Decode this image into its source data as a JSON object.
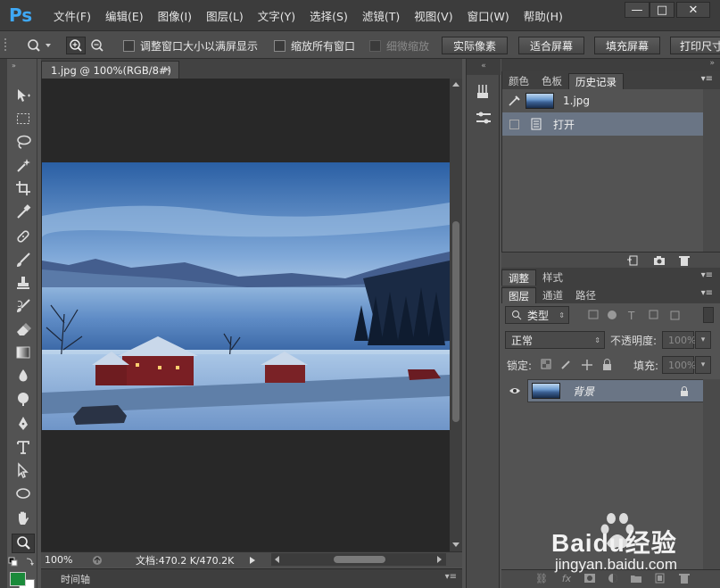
{
  "app": {
    "logo": "Ps",
    "accent": "#3fa8f5"
  },
  "menu": [
    "文件(F)",
    "编辑(E)",
    "图像(I)",
    "图层(L)",
    "文字(Y)",
    "选择(S)",
    "滤镜(T)",
    "视图(V)",
    "窗口(W)",
    "帮助(H)"
  ],
  "window_controls": {
    "minimize": "—",
    "restore": "□",
    "close": "✕"
  },
  "options": {
    "resize_windows": "调整窗口大小以满屏显示",
    "zoom_all": "缩放所有窗口",
    "scrubby_zoom": "细微缩放",
    "actual_pixels": "实际像素",
    "fit_screen": "适合屏幕",
    "fill_screen": "填充屏幕",
    "print_size": "打印尺寸"
  },
  "document": {
    "tab_title": "1.jpg @ 100%(RGB/8#)",
    "tab_close": "×",
    "zoom": "100%",
    "doc_info": "文档:470.2 K/470.2K",
    "timeline_label": "时间轴"
  },
  "history_panel": {
    "tabs": [
      "颜色",
      "色板",
      "历史记录"
    ],
    "active_tab": 2,
    "snapshot": "1.jpg",
    "steps": [
      "打开"
    ]
  },
  "layers_panel": {
    "top_tabs": [
      "调整",
      "样式"
    ],
    "tabs": [
      "图层",
      "通道",
      "路径"
    ],
    "filter_kind": "类型",
    "blend_mode": "正常",
    "opacity_label": "不透明度:",
    "opacity_value": "100%",
    "lock_label": "锁定:",
    "fill_label": "填充:",
    "fill_value": "100%",
    "layers": [
      {
        "name": "背景",
        "visible": true,
        "locked": true
      }
    ]
  },
  "watermark": {
    "brand": "Baidu经验",
    "url": "jingyan.baidu.com"
  },
  "colors": {
    "foreground": "#1a8a3a",
    "background": "#ffffff",
    "history_selected": "#6a7585"
  }
}
